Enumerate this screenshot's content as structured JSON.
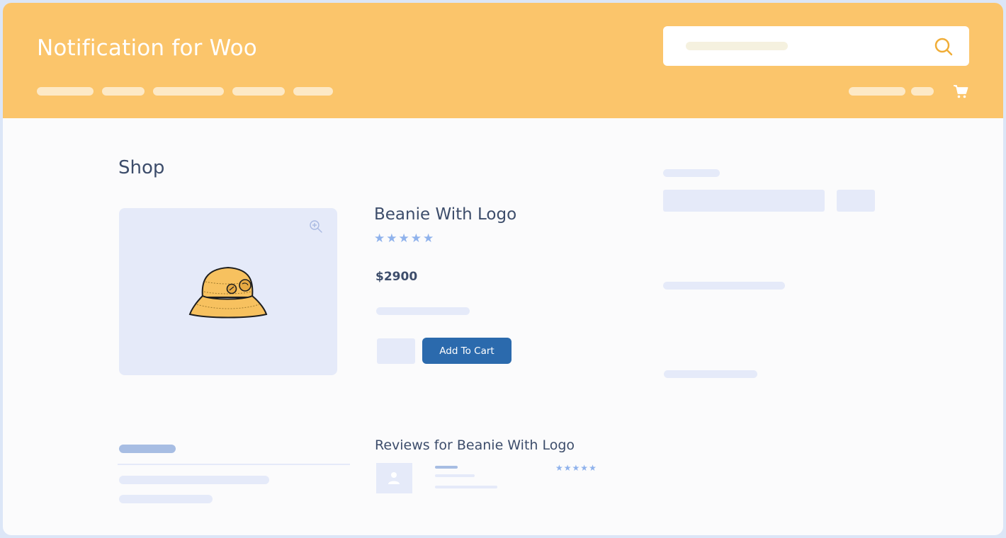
{
  "header": {
    "site_title": "Notification for Woo",
    "brand_color": "#fbc56b"
  },
  "nav": {
    "icons": [
      "search-icon",
      "cart-icon"
    ]
  },
  "main": {
    "page_title": "Shop",
    "product": {
      "name": "Beanie With Logo",
      "rating_stars": 5,
      "price": "$2900",
      "add_to_cart_label": "Add To Cart"
    },
    "reviews": {
      "title": "Reviews for Beanie With Logo",
      "rating_stars": 5
    }
  },
  "colors": {
    "accent": "#2b6aad",
    "skeleton": "#e5eaf9",
    "star": "#8fb2ec",
    "text": "#3d4d6b"
  }
}
